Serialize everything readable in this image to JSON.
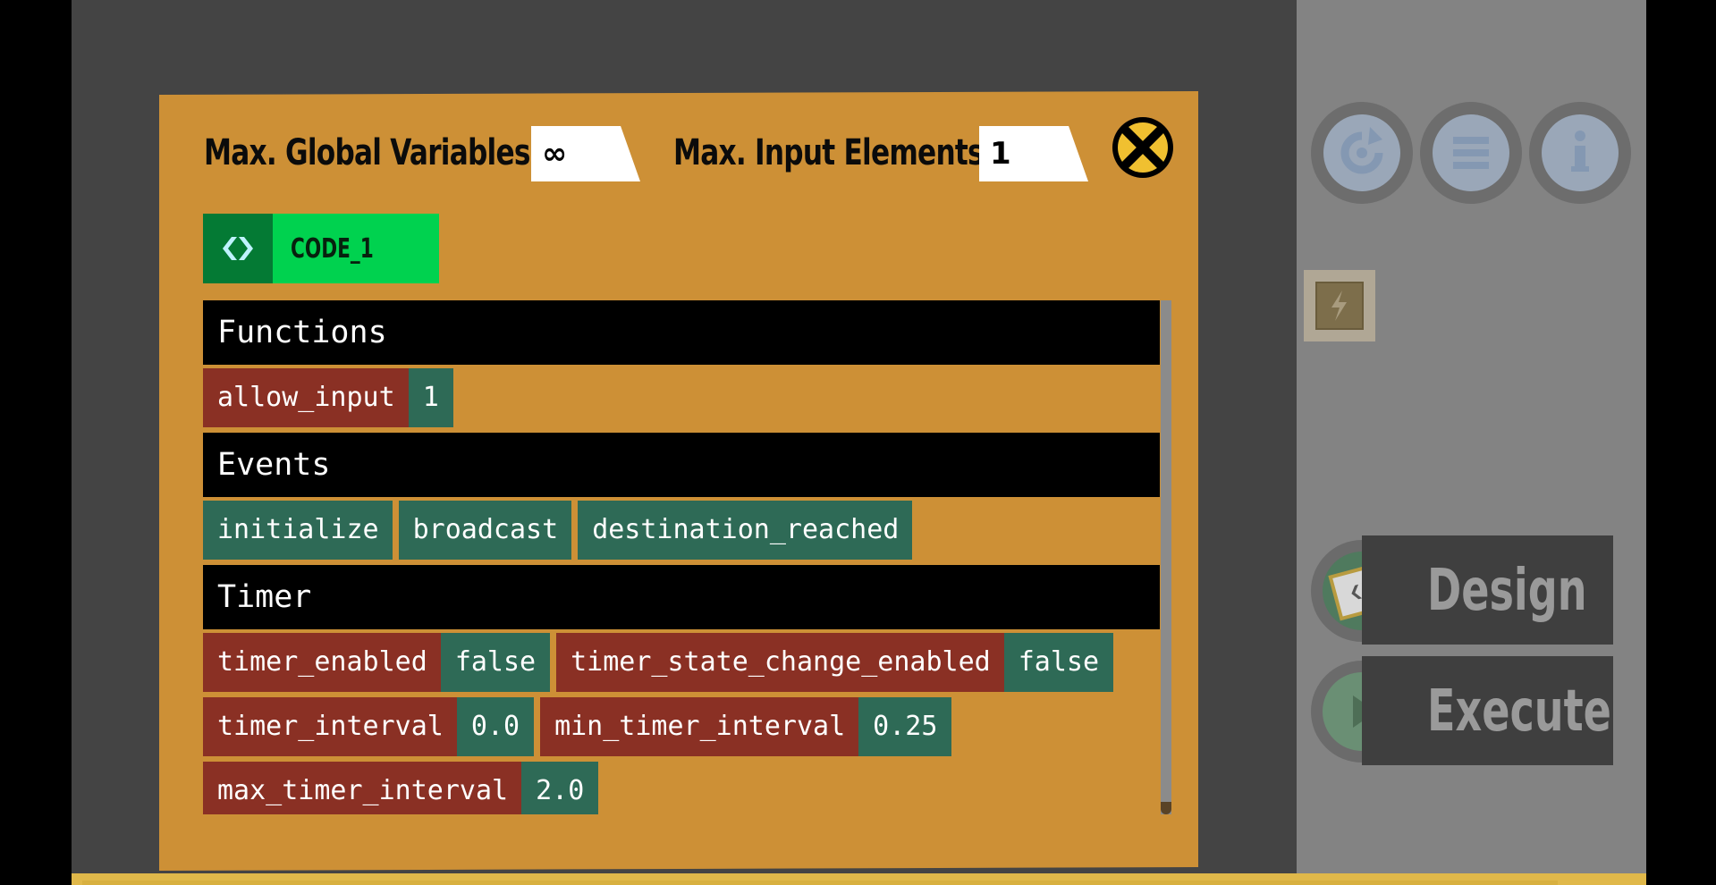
{
  "dialog": {
    "max_global_label": "Max. Global Variables:",
    "max_global_value": "∞",
    "max_input_label": "Max. Input Elements:",
    "max_input_value": "1",
    "code_tab_label": "CODE_1"
  },
  "sections": {
    "functions": {
      "title": "Functions",
      "items": [
        {
          "key": "allow_input",
          "value": "1"
        }
      ]
    },
    "events": {
      "title": "Events",
      "items": [
        "initialize",
        "broadcast",
        "destination_reached"
      ]
    },
    "timer": {
      "title": "Timer",
      "row1": [
        {
          "key": "timer_enabled",
          "value": "false"
        },
        {
          "key": "timer_state_change_enabled",
          "value": "false"
        }
      ],
      "row2": [
        {
          "key": "timer_interval",
          "value": "0.0"
        },
        {
          "key": "min_timer_interval",
          "value": "0.25"
        }
      ],
      "row3": [
        {
          "key": "max_timer_interval",
          "value": "2.0"
        }
      ]
    }
  },
  "sidebar": {
    "icons": [
      "refresh-icon",
      "menu-icon",
      "info-icon",
      "lightning-icon"
    ],
    "design_label": "Design",
    "execute_label": "Execute"
  },
  "colors": {
    "dialog_bg": "#cd9036",
    "key_chip": "#8a3024",
    "value_chip": "#2e6a56",
    "code_tab": "#00d24f",
    "close_ring": "#f0c030"
  }
}
